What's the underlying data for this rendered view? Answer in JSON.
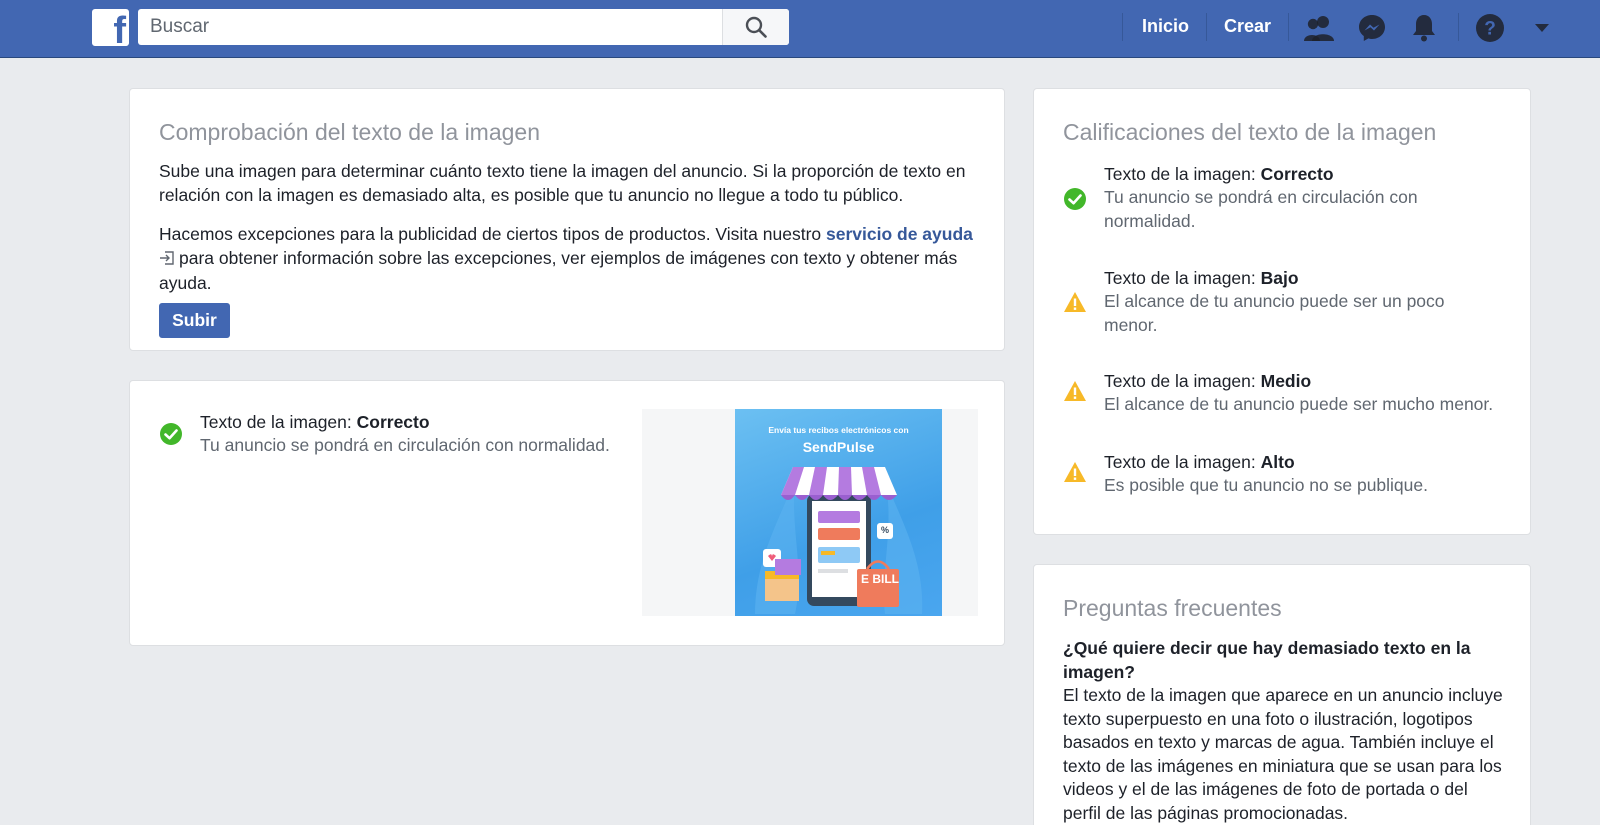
{
  "search": {
    "placeholder": "Buscar"
  },
  "nav": {
    "home": "Inicio",
    "create": "Crear"
  },
  "check_card": {
    "title": "Comprobación del texto de la imagen",
    "paragraph1": "Sube una imagen para determinar cuánto texto tiene la imagen del anuncio. Si la proporción de texto en relación con la imagen es demasiado alta, es posible que tu anuncio no llegue a todo tu público.",
    "paragraph2_start": "Hacemos excepciones para la publicidad de ciertos tipos de productos. Visita nuestro ",
    "help_link": "servicio de ayuda",
    "paragraph2_end": "para obtener información sobre las excepciones, ver ejemplos de imágenes con texto y obtener más ayuda.",
    "upload_label": "Subir"
  },
  "result_card": {
    "label": "Texto de la imagen: ",
    "rating": "Correcto",
    "description": "Tu anuncio se pondrá en circulación con normalidad.",
    "ad_image": {
      "headline": "Envía tus recibos electrónicos con",
      "brand": "SendPulse",
      "tag": "E BILL",
      "percent": "%"
    }
  },
  "ratings_card": {
    "title": "Calificaciones del texto de la imagen",
    "items": [
      {
        "label": "Texto de la imagen: ",
        "rating": "Correcto",
        "description": "Tu anuncio se pondrá en circulación con normalidad.",
        "icon": "check-icon",
        "color": "#42b72a"
      },
      {
        "label": "Texto de la imagen: ",
        "rating": "Bajo",
        "description": "El alcance de tu anuncio puede ser un poco menor.",
        "icon": "warning-icon",
        "color": "#f7b928"
      },
      {
        "label": "Texto de la imagen: ",
        "rating": "Medio",
        "description": "El alcance de tu anuncio puede ser mucho menor.",
        "icon": "warning-icon",
        "color": "#f7b928"
      },
      {
        "label": "Texto de la imagen: ",
        "rating": "Alto",
        "description": "Es posible que tu anuncio no se publique.",
        "icon": "warning-icon",
        "color": "#f7b928"
      }
    ]
  },
  "faq_card": {
    "title": "Preguntas frecuentes",
    "question": "¿Qué quiere decir que hay demasiado texto en la imagen?",
    "answer": "El texto de la imagen que aparece en un anuncio incluye texto superpuesto en una foto o ilustración, logotipos basados en texto y marcas de agua. También incluye el texto de las imágenes en miniatura que se usan para los videos y el de las imágenes de foto de portada o del perfil de las páginas promocionadas."
  },
  "colors": {
    "brand": "#4267b2",
    "success": "#42b72a",
    "warning": "#f7b928",
    "link": "#365899"
  }
}
